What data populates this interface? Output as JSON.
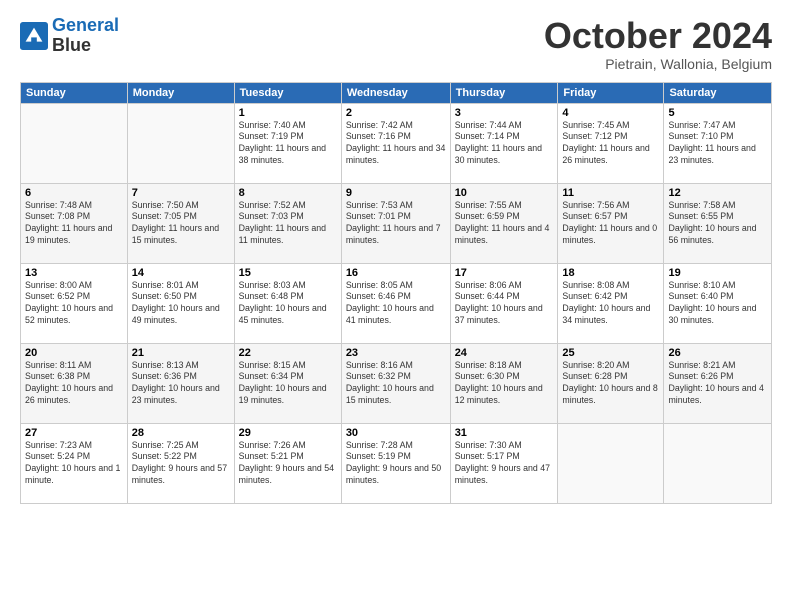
{
  "header": {
    "logo_line1": "General",
    "logo_line2": "Blue",
    "month": "October 2024",
    "location": "Pietrain, Wallonia, Belgium"
  },
  "weekdays": [
    "Sunday",
    "Monday",
    "Tuesday",
    "Wednesday",
    "Thursday",
    "Friday",
    "Saturday"
  ],
  "weeks": [
    [
      {
        "day": "",
        "info": ""
      },
      {
        "day": "",
        "info": ""
      },
      {
        "day": "1",
        "info": "Sunrise: 7:40 AM\nSunset: 7:19 PM\nDaylight: 11 hours and 38 minutes."
      },
      {
        "day": "2",
        "info": "Sunrise: 7:42 AM\nSunset: 7:16 PM\nDaylight: 11 hours and 34 minutes."
      },
      {
        "day": "3",
        "info": "Sunrise: 7:44 AM\nSunset: 7:14 PM\nDaylight: 11 hours and 30 minutes."
      },
      {
        "day": "4",
        "info": "Sunrise: 7:45 AM\nSunset: 7:12 PM\nDaylight: 11 hours and 26 minutes."
      },
      {
        "day": "5",
        "info": "Sunrise: 7:47 AM\nSunset: 7:10 PM\nDaylight: 11 hours and 23 minutes."
      }
    ],
    [
      {
        "day": "6",
        "info": "Sunrise: 7:48 AM\nSunset: 7:08 PM\nDaylight: 11 hours and 19 minutes."
      },
      {
        "day": "7",
        "info": "Sunrise: 7:50 AM\nSunset: 7:05 PM\nDaylight: 11 hours and 15 minutes."
      },
      {
        "day": "8",
        "info": "Sunrise: 7:52 AM\nSunset: 7:03 PM\nDaylight: 11 hours and 11 minutes."
      },
      {
        "day": "9",
        "info": "Sunrise: 7:53 AM\nSunset: 7:01 PM\nDaylight: 11 hours and 7 minutes."
      },
      {
        "day": "10",
        "info": "Sunrise: 7:55 AM\nSunset: 6:59 PM\nDaylight: 11 hours and 4 minutes."
      },
      {
        "day": "11",
        "info": "Sunrise: 7:56 AM\nSunset: 6:57 PM\nDaylight: 11 hours and 0 minutes."
      },
      {
        "day": "12",
        "info": "Sunrise: 7:58 AM\nSunset: 6:55 PM\nDaylight: 10 hours and 56 minutes."
      }
    ],
    [
      {
        "day": "13",
        "info": "Sunrise: 8:00 AM\nSunset: 6:52 PM\nDaylight: 10 hours and 52 minutes."
      },
      {
        "day": "14",
        "info": "Sunrise: 8:01 AM\nSunset: 6:50 PM\nDaylight: 10 hours and 49 minutes."
      },
      {
        "day": "15",
        "info": "Sunrise: 8:03 AM\nSunset: 6:48 PM\nDaylight: 10 hours and 45 minutes."
      },
      {
        "day": "16",
        "info": "Sunrise: 8:05 AM\nSunset: 6:46 PM\nDaylight: 10 hours and 41 minutes."
      },
      {
        "day": "17",
        "info": "Sunrise: 8:06 AM\nSunset: 6:44 PM\nDaylight: 10 hours and 37 minutes."
      },
      {
        "day": "18",
        "info": "Sunrise: 8:08 AM\nSunset: 6:42 PM\nDaylight: 10 hours and 34 minutes."
      },
      {
        "day": "19",
        "info": "Sunrise: 8:10 AM\nSunset: 6:40 PM\nDaylight: 10 hours and 30 minutes."
      }
    ],
    [
      {
        "day": "20",
        "info": "Sunrise: 8:11 AM\nSunset: 6:38 PM\nDaylight: 10 hours and 26 minutes."
      },
      {
        "day": "21",
        "info": "Sunrise: 8:13 AM\nSunset: 6:36 PM\nDaylight: 10 hours and 23 minutes."
      },
      {
        "day": "22",
        "info": "Sunrise: 8:15 AM\nSunset: 6:34 PM\nDaylight: 10 hours and 19 minutes."
      },
      {
        "day": "23",
        "info": "Sunrise: 8:16 AM\nSunset: 6:32 PM\nDaylight: 10 hours and 15 minutes."
      },
      {
        "day": "24",
        "info": "Sunrise: 8:18 AM\nSunset: 6:30 PM\nDaylight: 10 hours and 12 minutes."
      },
      {
        "day": "25",
        "info": "Sunrise: 8:20 AM\nSunset: 6:28 PM\nDaylight: 10 hours and 8 minutes."
      },
      {
        "day": "26",
        "info": "Sunrise: 8:21 AM\nSunset: 6:26 PM\nDaylight: 10 hours and 4 minutes."
      }
    ],
    [
      {
        "day": "27",
        "info": "Sunrise: 7:23 AM\nSunset: 5:24 PM\nDaylight: 10 hours and 1 minute."
      },
      {
        "day": "28",
        "info": "Sunrise: 7:25 AM\nSunset: 5:22 PM\nDaylight: 9 hours and 57 minutes."
      },
      {
        "day": "29",
        "info": "Sunrise: 7:26 AM\nSunset: 5:21 PM\nDaylight: 9 hours and 54 minutes."
      },
      {
        "day": "30",
        "info": "Sunrise: 7:28 AM\nSunset: 5:19 PM\nDaylight: 9 hours and 50 minutes."
      },
      {
        "day": "31",
        "info": "Sunrise: 7:30 AM\nSunset: 5:17 PM\nDaylight: 9 hours and 47 minutes."
      },
      {
        "day": "",
        "info": ""
      },
      {
        "day": "",
        "info": ""
      }
    ]
  ]
}
